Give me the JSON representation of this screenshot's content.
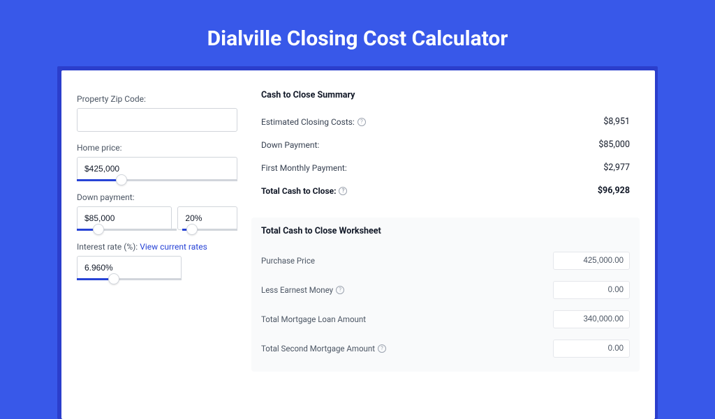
{
  "page": {
    "title": "Dialville Closing Cost Calculator"
  },
  "form": {
    "zip_label": "Property Zip Code:",
    "zip_value": "",
    "home_price_label": "Home price:",
    "home_price_value": "$425,000",
    "down_payment_label": "Down payment:",
    "down_payment_value": "$85,000",
    "down_payment_pct": "20%",
    "interest_label": "Interest rate (%): ",
    "interest_link": "View current rates",
    "interest_value": "6.960%"
  },
  "summary": {
    "title": "Cash to Close Summary",
    "rows": [
      {
        "label": "Estimated Closing Costs:",
        "value": "$8,951",
        "help": true
      },
      {
        "label": "Down Payment:",
        "value": "$85,000",
        "help": false
      },
      {
        "label": "First Monthly Payment:",
        "value": "$2,977",
        "help": false
      }
    ],
    "total_label": "Total Cash to Close:",
    "total_value": "$96,928"
  },
  "worksheet": {
    "title": "Total Cash to Close Worksheet",
    "rows": [
      {
        "label": "Purchase Price",
        "value": "425,000.00",
        "help": false
      },
      {
        "label": "Less Earnest Money",
        "value": "0.00",
        "help": true
      },
      {
        "label": "Total Mortgage Loan Amount",
        "value": "340,000.00",
        "help": false
      },
      {
        "label": "Total Second Mortgage Amount",
        "value": "0.00",
        "help": true
      }
    ]
  },
  "sliders": {
    "home_price_pct": 28,
    "down_payment_pct": 22,
    "down_payment_pct2": 18,
    "interest_pct": 35
  }
}
